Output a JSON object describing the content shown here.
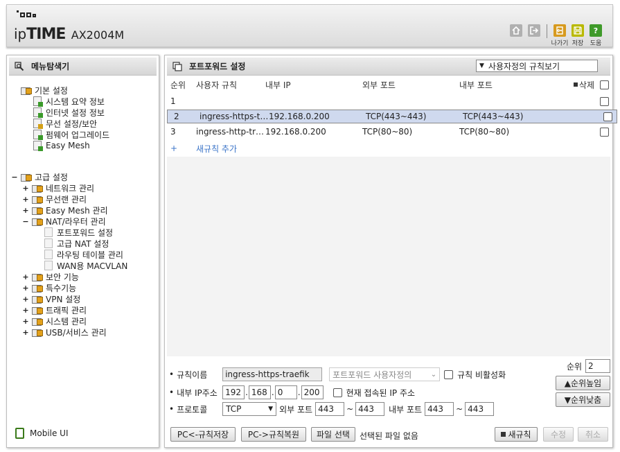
{
  "header": {
    "logo_ip": "ip",
    "logo_time": "TIME",
    "model": "AX2004M",
    "icons": [
      {
        "name": "home-icon",
        "caption": "",
        "color": "#9a9a9a"
      },
      {
        "name": "logout-icon",
        "caption": "",
        "color": "#9a9a9a"
      },
      {
        "name": "exit-icon",
        "caption": "나가기",
        "color": "#d79a1e"
      },
      {
        "name": "save-icon",
        "caption": "저장",
        "color": "#b8b800"
      },
      {
        "name": "help-icon",
        "caption": "도움",
        "color": "#3f9a2a"
      }
    ]
  },
  "sidebar": {
    "title": "메뉴탐색기",
    "basic": {
      "label": "기본 설정",
      "items": [
        "시스템 요약 정보",
        "인터넷 설정 정보",
        "무선 설정/보안",
        "펌웨어 업그레이드",
        "Easy Mesh"
      ]
    },
    "advanced": {
      "label": "고급 설정",
      "items": [
        {
          "label": "네트워크 관리",
          "toggle": "+"
        },
        {
          "label": "무선랜 관리",
          "toggle": "+"
        },
        {
          "label": "Easy Mesh 관리",
          "toggle": "+"
        },
        {
          "label": "NAT/라우터 관리",
          "toggle": "−"
        }
      ],
      "nat_children": [
        "포트포워드 설정",
        "고급 NAT 설정",
        "라우팅 테이블 관리",
        "WAN용 MACVLAN"
      ],
      "more": [
        {
          "label": "보안 기능",
          "toggle": "+"
        },
        {
          "label": "특수기능",
          "toggle": "+"
        },
        {
          "label": "VPN 설정",
          "toggle": "+"
        },
        {
          "label": "트래픽 관리",
          "toggle": "+"
        },
        {
          "label": "시스템 관리",
          "toggle": "+"
        },
        {
          "label": "USB/서비스 관리",
          "toggle": "+"
        }
      ]
    },
    "mobile": "Mobile UI"
  },
  "main": {
    "title": "포트포워드 설정",
    "view_select": "사용자정의 규칙보기",
    "columns": {
      "order": "순위",
      "name": "사용자 규칙",
      "ip": "내부 IP",
      "ext": "외부 포트",
      "int": "내부 포트",
      "del": "삭제"
    },
    "rows": [
      {
        "order": "2",
        "name": "ingress-https-traefik",
        "ip": "192.168.0.200",
        "ext": "TCP(443~443)",
        "int": "TCP(443~443)"
      },
      {
        "order": "3",
        "name": "ingress-http-traefik",
        "ip": "192.168.0.200",
        "ext": "TCP(80~80)",
        "int": "TCP(80~80)"
      }
    ],
    "add_plus": "+",
    "add_label": "새규칙 추가",
    "form": {
      "rule_name_label": "규칙이름",
      "rule_name_value": "ingress-https-traefik",
      "preset_select": "포트포워드 사용자정의",
      "disable_label": "규칙 비활성화",
      "ip_label": "내부 IP주소",
      "ip1": "192",
      "ip2": "168",
      "ip3": "0",
      "ip4": "200",
      "current_ip_label": "현재 접속된 IP 주소",
      "proto_label": "프로토콜",
      "proto_value": "TCP",
      "ext_label": "외부 포트",
      "ext_from": "443",
      "ext_to": "443",
      "int_label": "내부 포트",
      "int_from": "443",
      "int_to": "443",
      "tilde": "~",
      "order_label": "순위",
      "order_value": "2",
      "up_btn": "▲순위높임",
      "down_btn": "▼순위낮춤"
    },
    "buttons": {
      "pc_save": "PC<-규칙저장",
      "pc_restore": "PC->규칙복원",
      "file_select": "파일 선택",
      "no_file": "선택된 파일 없음",
      "new_rule": "새규칙",
      "modify": "수정",
      "cancel": "취소"
    }
  }
}
